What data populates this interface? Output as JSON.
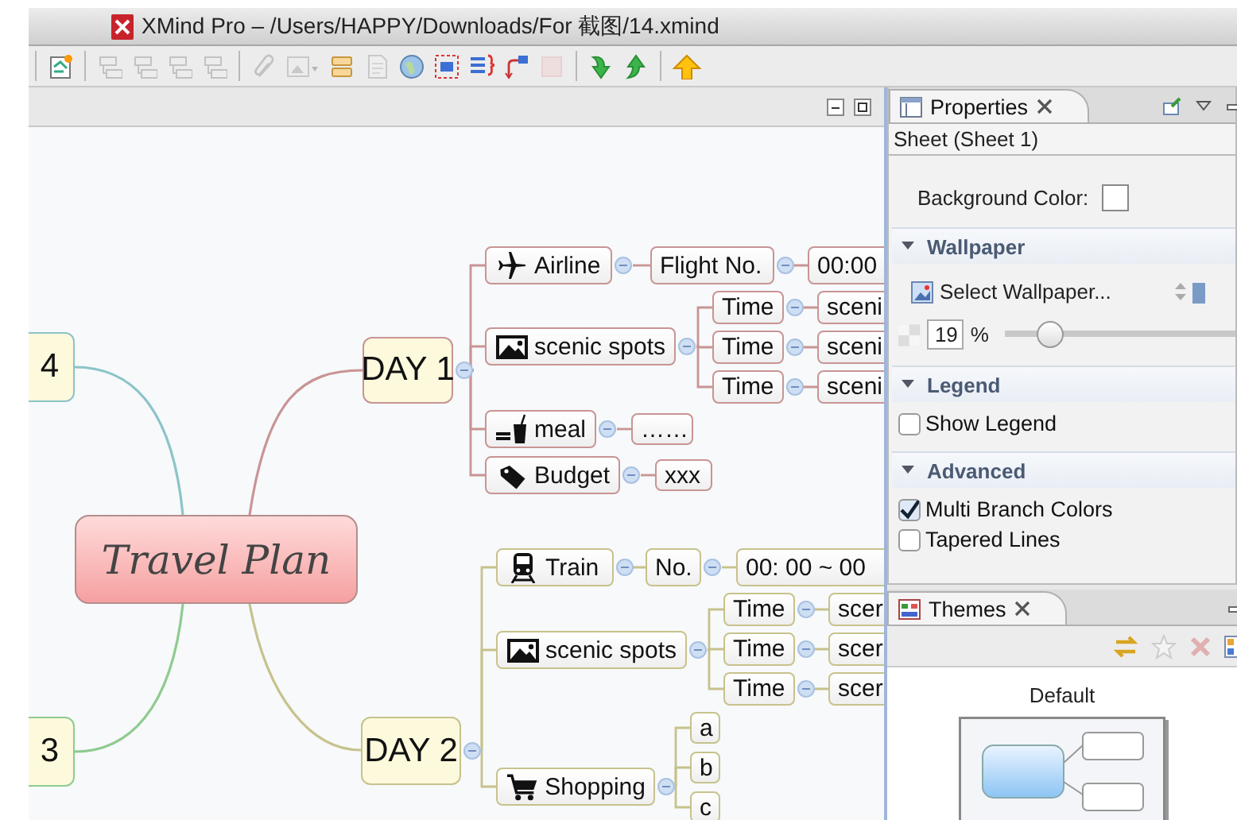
{
  "window": {
    "title": "XMind Pro – /Users/HAPPY/Downloads/For 截图/14.xmind"
  },
  "toolbar": [
    [
      {
        "kind": "doc",
        "disabled": false
      }
    ],
    [
      {
        "kind": "box",
        "disabled": true
      },
      {
        "kind": "box",
        "disabled": true
      },
      {
        "kind": "box",
        "disabled": true
      },
      {
        "kind": "box",
        "disabled": true
      }
    ],
    [
      {
        "kind": "clip",
        "disabled": true
      },
      {
        "kind": "picture",
        "disabled": true
      },
      {
        "kind": "bars",
        "disabled": false
      },
      {
        "kind": "page",
        "disabled": true
      },
      {
        "kind": "globe",
        "disabled": false
      },
      {
        "kind": "dashbox",
        "disabled": false
      },
      {
        "kind": "lines",
        "disabled": false
      },
      {
        "kind": "arrows",
        "disabled": false
      },
      {
        "kind": "square",
        "disabled": true
      }
    ],
    [
      {
        "kind": "down",
        "disabled": false
      },
      {
        "kind": "up",
        "disabled": false
      }
    ],
    [
      {
        "kind": "bigup",
        "disabled": false
      }
    ]
  ],
  "map": {
    "central": "Travel Plan",
    "branches": [
      {
        "text": "DAY 1",
        "color": "#c99494",
        "expanded": true,
        "children": [
          {
            "text": "Airline",
            "expanded": true,
            "children": [
              {
                "text": "Flight No.",
                "expanded": true,
                "children": [
                  {
                    "text": "00:00"
                  }
                ]
              }
            ]
          },
          {
            "text": "scenic spots",
            "expanded": true,
            "children": [
              {
                "text": "Time",
                "expanded": true,
                "children": [
                  {
                    "text": "sceni"
                  }
                ]
              },
              {
                "text": "Time",
                "expanded": true,
                "children": [
                  {
                    "text": "sceni"
                  }
                ]
              },
              {
                "text": "Time",
                "expanded": true,
                "children": [
                  {
                    "text": "sceni"
                  }
                ]
              }
            ]
          },
          {
            "text": "meal",
            "expanded": true,
            "children": [
              {
                "text": "……"
              }
            ]
          },
          {
            "text": "Budget",
            "expanded": true,
            "children": [
              {
                "text": "xxx"
              }
            ]
          }
        ]
      },
      {
        "text": "DAY 2",
        "color": "#c7c28c",
        "expanded": true,
        "children": [
          {
            "text": "Train",
            "expanded": true,
            "children": [
              {
                "text": "No.",
                "expanded": true,
                "children": [
                  {
                    "text": "00:  00 ~ 00"
                  }
                ]
              }
            ]
          },
          {
            "text": "scenic spots",
            "expanded": true,
            "children": [
              {
                "text": "Time",
                "expanded": true,
                "children": [
                  {
                    "text": "scer"
                  }
                ]
              },
              {
                "text": "Time",
                "expanded": true,
                "children": [
                  {
                    "text": "scer"
                  }
                ]
              },
              {
                "text": "Time",
                "expanded": true,
                "children": [
                  {
                    "text": "scer"
                  }
                ]
              }
            ]
          },
          {
            "text": "Shopping",
            "expanded": true,
            "children": [
              {
                "text": "a"
              },
              {
                "text": "b"
              },
              {
                "text": "c"
              }
            ]
          }
        ]
      },
      {
        "text": "4",
        "color": "#8cc4c8"
      },
      {
        "text": "3",
        "color": "#8fcb8f"
      }
    ]
  },
  "properties": {
    "tab": "Properties",
    "sheet": "Sheet (Sheet 1)",
    "background_color_label": "Background Color:",
    "sections": [
      {
        "kind": "wallpaper",
        "title": "Wallpaper",
        "expanded": true,
        "select_label": "Select Wallpaper...",
        "opacity": "19",
        "unit": "%",
        "level": 0.19
      },
      {
        "kind": "options",
        "title": "Legend",
        "expanded": true,
        "options": [
          {
            "label": "Show Legend",
            "checked": false
          }
        ]
      },
      {
        "kind": "options",
        "title": "Advanced",
        "expanded": true,
        "options": [
          {
            "label": "Multi Branch Colors",
            "checked": true
          },
          {
            "label": "Tapered Lines",
            "checked": false
          }
        ]
      }
    ]
  },
  "themes": {
    "tab": "Themes",
    "theme": "Default"
  }
}
